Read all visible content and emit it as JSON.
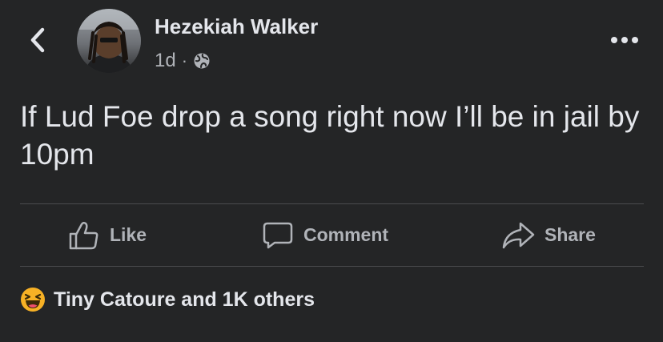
{
  "post": {
    "author": "Hezekiah Walker",
    "time": "1d",
    "separator": "·",
    "audience_icon": "globe-icon",
    "text": "If Lud Foe drop a song right now I’ll be in jail by 10pm"
  },
  "actions": {
    "like": "Like",
    "comment": "Comment",
    "share": "Share"
  },
  "reactions": {
    "icon": "haha-emoji-icon",
    "summary": "Tiny Catoure and 1K others"
  },
  "colors": {
    "background": "#242526",
    "primary_text": "#e4e6eb",
    "secondary_text": "#b0b3b8",
    "divider": "#4a4b4d",
    "haha_yellow": "#f7b125"
  }
}
